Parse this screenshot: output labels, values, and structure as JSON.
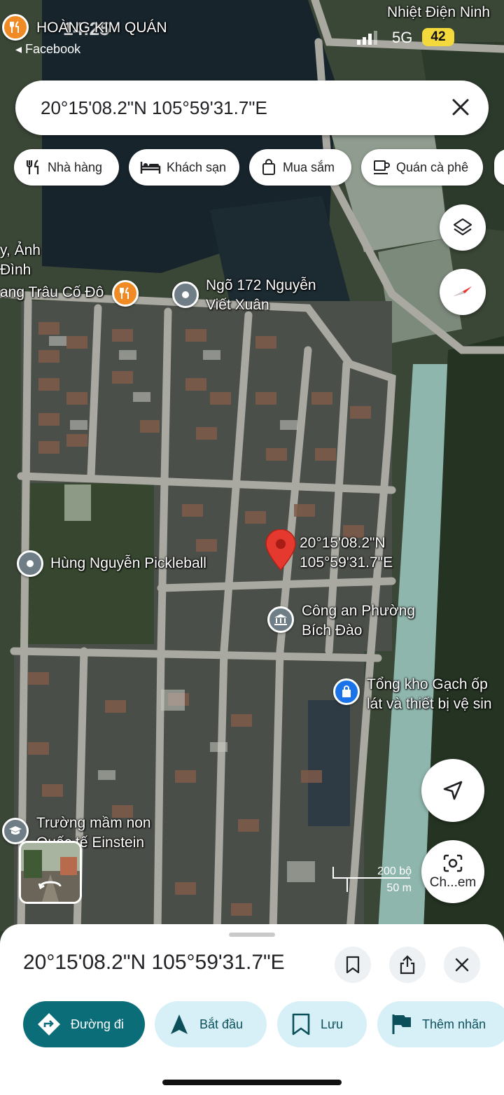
{
  "status_bar": {
    "time": "14:25",
    "back_app": "◂ Facebook",
    "network": "5G",
    "battery": "42"
  },
  "search": {
    "query": "20°15'08.2\"N 105°59'31.7\"E"
  },
  "categories": [
    {
      "label": "Nhà hàng",
      "icon": "fork-knife-icon"
    },
    {
      "label": "Khách sạn",
      "icon": "bed-icon"
    },
    {
      "label": "Mua sắm",
      "icon": "shopping-bag-icon"
    },
    {
      "label": "Quán cà phê",
      "icon": "coffee-cup-icon"
    }
  ],
  "map_labels": {
    "top_right": "Nhiệt Điện Ninh",
    "top_left_restaurant": "HOÀNG KIM QUÁN",
    "left_fragment_1": "y, Ảnh",
    "left_fragment_2": "Đình",
    "left_restaurant": "ang Trâu Cố Đô",
    "lane_1": "Ngõ 172 Nguyễn",
    "lane_2": "Viết Xuân",
    "pickleball": "Hùng Nguyễn Pickleball",
    "dropped_pin_1": "20°15'08.2\"N",
    "dropped_pin_2": "105°59'31.7\"E",
    "police_1": "Công an Phường",
    "police_2": "Bích Đào",
    "store_1": "Tổng kho Gạch ốp",
    "store_2": "lát và thiết bị vệ sin",
    "school_1": "Trường mầm non",
    "school_2": "Quốc tế Einstein"
  },
  "scale_bar": {
    "imperial": "200 bộ",
    "metric": "50 m"
  },
  "controls": {
    "lens_label": "Ch...em"
  },
  "place_sheet": {
    "title": "20°15'08.2\"N 105°59'31.7\"E",
    "actions": [
      {
        "label": "Đường đi",
        "icon": "directions-icon"
      },
      {
        "label": "Bắt đầu",
        "icon": "navigation-arrow-icon"
      },
      {
        "label": "Lưu",
        "icon": "bookmark-icon"
      },
      {
        "label": "Thêm nhãn",
        "icon": "flag-icon"
      }
    ]
  },
  "colors": {
    "accent_teal": "#0b6d78",
    "secondary_chip": "#d7f0f7",
    "pin_red": "#e5392f",
    "poi_orange": "#f08a24",
    "poi_gray": "#6f7d86",
    "poi_blue": "#1a73e8"
  }
}
